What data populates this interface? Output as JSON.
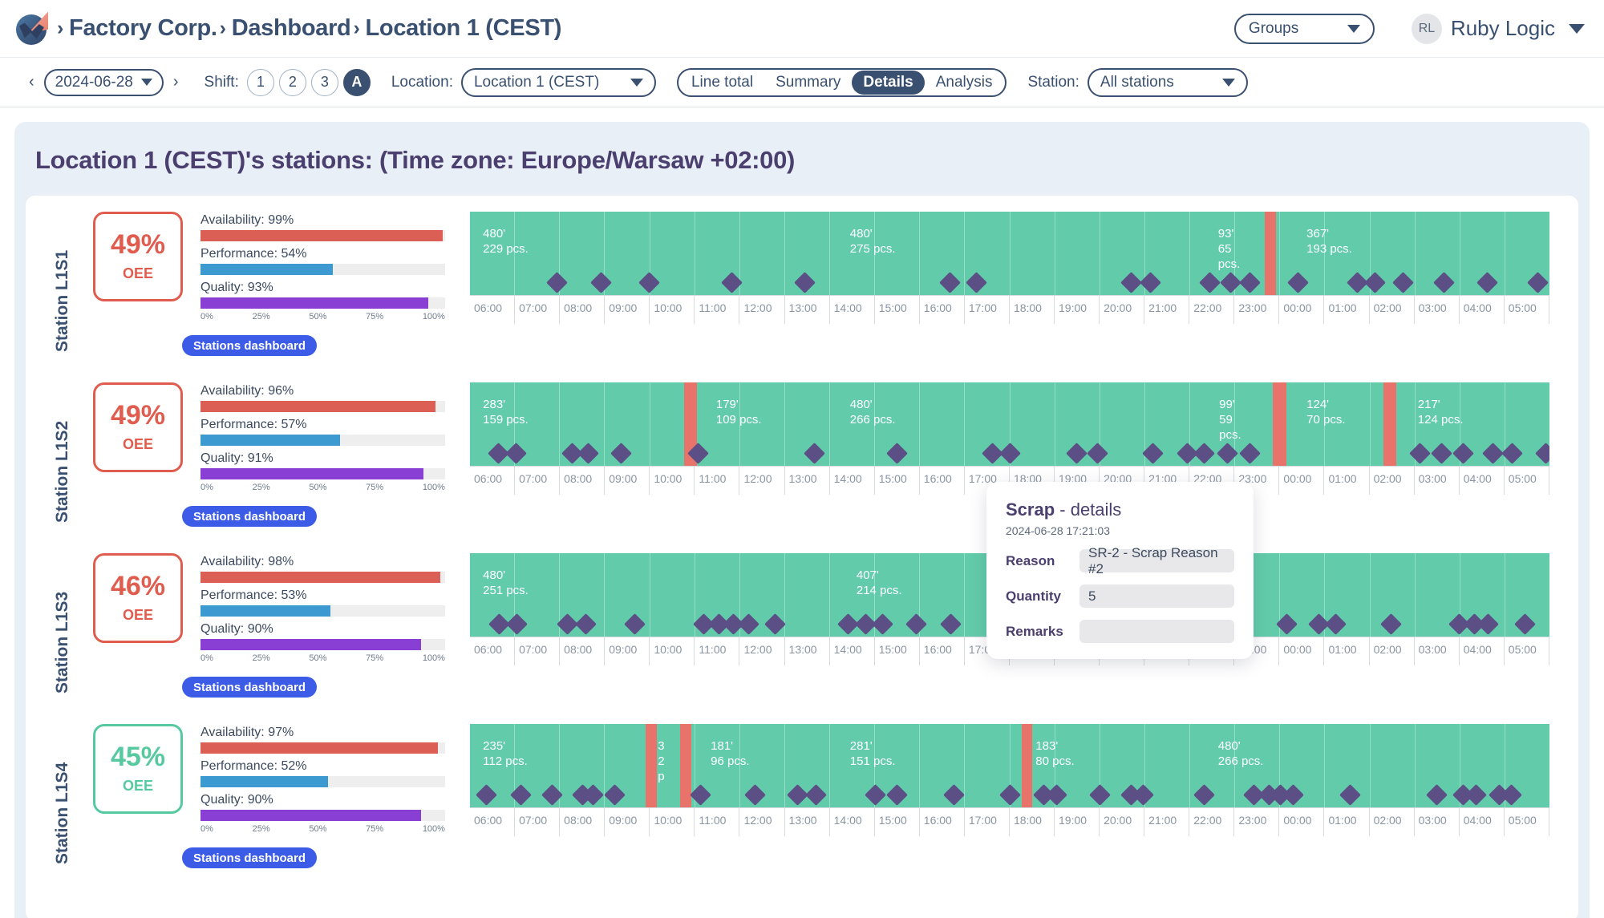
{
  "topbar": {
    "logo_name": "factory-logo",
    "breadcrumb": [
      "Factory Corp.",
      "Dashboard",
      "Location 1 (CEST)"
    ],
    "separator": "›",
    "groups_label": "Groups",
    "user_initials": "RL",
    "user_name": "Ruby Logic"
  },
  "subbar": {
    "prev_arrow": "‹",
    "next_arrow": "›",
    "date_value": "2024-06-28",
    "shift_label": "Shift:",
    "shifts": [
      "1",
      "2",
      "3",
      "A"
    ],
    "active_shift": "A",
    "location_label": "Location:",
    "location_value": "Location 1 (CEST)",
    "views": [
      "Line total",
      "Summary",
      "Details",
      "Analysis"
    ],
    "active_view": "Details",
    "station_label": "Station:",
    "station_value": "All stations"
  },
  "panel": {
    "title": "Location 1 (CEST)'s stations: (Time zone: Europe/Warsaw +02:00)",
    "dashboard_button": "Stations dashboard",
    "scale_ticks": [
      "0%",
      "25%",
      "50%",
      "75%",
      "100%"
    ],
    "hours": [
      "06:00",
      "07:00",
      "08:00",
      "09:00",
      "10:00",
      "11:00",
      "12:00",
      "13:00",
      "14:00",
      "15:00",
      "16:00",
      "17:00",
      "18:00",
      "19:00",
      "20:00",
      "21:00",
      "22:00",
      "23:00",
      "00:00",
      "01:00",
      "02:00",
      "03:00",
      "04:00",
      "05:00"
    ]
  },
  "colors": {
    "availability": "#dc5f55",
    "performance": "#3d9ad1",
    "quality": "#8a3fd4",
    "run": "#62ccaa",
    "stop": "#e8736b",
    "scrap_marker": "#5b4f86",
    "oee_bad": "#e05c4f",
    "oee_good": "#57c9a0",
    "accent": "#3c5ce8",
    "panel_bg": "#e9eff7"
  },
  "stations": [
    {
      "name": "Station L1S1",
      "oee": "49%",
      "oee_caption": "OEE",
      "oee_state": "bad",
      "metrics": [
        {
          "label": "Availability: 99%",
          "value": 99,
          "color_key": "availability"
        },
        {
          "label": "Performance: 54%",
          "value": 54,
          "color_key": "performance"
        },
        {
          "label": "Quality: 93%",
          "value": 93,
          "color_key": "quality"
        }
      ],
      "segments": [
        {
          "label": "480'\n229 pcs.",
          "left_pct": 1.2,
          "top_offset": 0
        },
        {
          "label": "480'\n275 pcs.",
          "left_pct": 35.2,
          "top_offset": 0
        },
        {
          "label": "93'\n65\npcs.",
          "left_pct": 69.3,
          "top_offset": 0
        },
        {
          "label": "367'\n193 pcs.",
          "left_pct": 77.5,
          "top_offset": 0
        }
      ],
      "stops": [
        {
          "left_pct": 73.6,
          "width_pct": 1.1
        }
      ],
      "markers": [
        8.0,
        12.1,
        16.6,
        24.2,
        31.0,
        44.4,
        46.9,
        61.2,
        63.0,
        68.5,
        70.4,
        72.2,
        76.7,
        82.2,
        83.8,
        86.4,
        90.2,
        94.2,
        98.9
      ]
    },
    {
      "name": "Station L1S2",
      "oee": "49%",
      "oee_caption": "OEE",
      "oee_state": "bad",
      "metrics": [
        {
          "label": "Availability: 96%",
          "value": 96,
          "color_key": "availability"
        },
        {
          "label": "Performance: 57%",
          "value": 57,
          "color_key": "performance"
        },
        {
          "label": "Quality: 91%",
          "value": 91,
          "color_key": "quality"
        }
      ],
      "segments": [
        {
          "label": "283'\n159 pcs.",
          "left_pct": 1.2,
          "top_offset": 0
        },
        {
          "label": "179'\n109 pcs.",
          "left_pct": 22.8,
          "top_offset": 0
        },
        {
          "label": "480'\n266 pcs.",
          "left_pct": 35.2,
          "top_offset": 0
        },
        {
          "label": "99'\n59\npcs.",
          "left_pct": 69.4,
          "top_offset": 0
        },
        {
          "label": "124'\n70 pcs.",
          "left_pct": 77.5,
          "top_offset": 0
        },
        {
          "label": "217'\n124 pcs.",
          "left_pct": 87.8,
          "top_offset": 0
        }
      ],
      "stops": [
        {
          "left_pct": 19.8,
          "width_pct": 1.2
        },
        {
          "left_pct": 74.4,
          "width_pct": 1.2
        },
        {
          "left_pct": 84.6,
          "width_pct": 1.2
        }
      ],
      "markers": [
        2.6,
        4.2,
        9.4,
        10.9,
        14.0,
        21.1,
        31.9,
        39.5,
        48.4,
        50.0,
        56.2,
        58.1,
        63.2,
        66.4,
        68.0,
        70.1,
        72.2,
        88.0,
        90.0,
        92.0,
        94.7,
        96.5,
        99.6
      ]
    },
    {
      "name": "Station L1S3",
      "oee": "46%",
      "oee_caption": "OEE",
      "oee_state": "bad",
      "metrics": [
        {
          "label": "Availability: 98%",
          "value": 98,
          "color_key": "availability"
        },
        {
          "label": "Performance: 53%",
          "value": 53,
          "color_key": "performance"
        },
        {
          "label": "Quality: 90%",
          "value": 90,
          "color_key": "quality"
        }
      ],
      "segments": [
        {
          "label": "480'\n251 pcs.",
          "left_pct": 1.2,
          "top_offset": 0
        },
        {
          "label": "407'\n214 pcs.",
          "left_pct": 35.8,
          "top_offset": 0
        },
        {
          "label": "pcs.",
          "left_pct": 70.6,
          "top_offset": 0
        }
      ],
      "stops": [
        {
          "left_pct": 62.0,
          "width_pct": 1.1
        }
      ],
      "markers": [
        2.7,
        4.3,
        9.0,
        10.7,
        15.2,
        21.6,
        23.0,
        24.4,
        25.8,
        28.2,
        35.0,
        36.6,
        38.2,
        41.3,
        44.5,
        51.2,
        57.5,
        59.1,
        67.6,
        75.6,
        78.6,
        80.2,
        85.3,
        91.6,
        93.0,
        94.3,
        97.7
      ]
    },
    {
      "name": "Station L1S4",
      "oee": "45%",
      "oee_caption": "OEE",
      "oee_state": "good",
      "metrics": [
        {
          "label": "Availability: 97%",
          "value": 97,
          "color_key": "availability"
        },
        {
          "label": "Performance: 52%",
          "value": 52,
          "color_key": "performance"
        },
        {
          "label": "Quality: 90%",
          "value": 90,
          "color_key": "quality"
        }
      ],
      "segments": [
        {
          "label": "235'\n112 pcs.",
          "left_pct": 1.2,
          "top_offset": 0
        },
        {
          "label": "3\n2\np",
          "left_pct": 17.4,
          "top_offset": 0
        },
        {
          "label": "181'\n96 pcs.",
          "left_pct": 22.3,
          "top_offset": 0
        },
        {
          "label": "281'\n151 pcs.",
          "left_pct": 35.2,
          "top_offset": 0
        },
        {
          "label": "183'\n80 pcs.",
          "left_pct": 52.4,
          "top_offset": 0
        },
        {
          "label": "480'\n266 pcs.",
          "left_pct": 69.3,
          "top_offset": 0
        }
      ],
      "stops": [
        {
          "left_pct": 16.3,
          "width_pct": 1.0
        },
        {
          "left_pct": 19.5,
          "width_pct": 1.0
        },
        {
          "left_pct": 51.1,
          "width_pct": 1.0
        }
      ],
      "markers": [
        1.5,
        4.7,
        7.6,
        10.4,
        11.4,
        13.4,
        21.3,
        26.4,
        30.3,
        32.0,
        37.5,
        39.5,
        44.8,
        50.0,
        53.1,
        54.3,
        58.3,
        61.2,
        62.3,
        68.0,
        72.6,
        74.0,
        75.0,
        76.2,
        81.5,
        89.5,
        92.0,
        93.2,
        95.3,
        96.4
      ]
    }
  ],
  "popup": {
    "title_bold": "Scrap",
    "title_rest": " - details",
    "timestamp": "2024-06-28 17:21:03",
    "fields": [
      {
        "key": "Reason",
        "value": "SR-2 - Scrap Reason #2"
      },
      {
        "key": "Quantity",
        "value": "5"
      },
      {
        "key": "Remarks",
        "value": ""
      }
    ]
  }
}
